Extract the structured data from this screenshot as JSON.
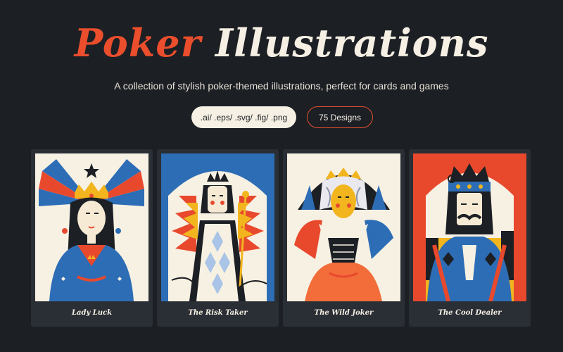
{
  "header": {
    "title_word1": "Poker",
    "title_word2": "Illustrations",
    "subtitle": "A collection of stylish poker-themed illustrations, perfect for cards and games"
  },
  "badges": {
    "formats": ".ai/ .eps/ .svg/ .fig/ .png",
    "count": "75 Designs"
  },
  "cards": [
    {
      "title": "Lady Luck"
    },
    {
      "title": "The Risk Taker"
    },
    {
      "title": "The Wild Joker"
    },
    {
      "title": "The Cool Dealer"
    }
  ],
  "colors": {
    "background": "#1c1f24",
    "accent_red": "#ea4e2d",
    "cream": "#f6f0e4",
    "card_blue": "#2d6db5"
  }
}
